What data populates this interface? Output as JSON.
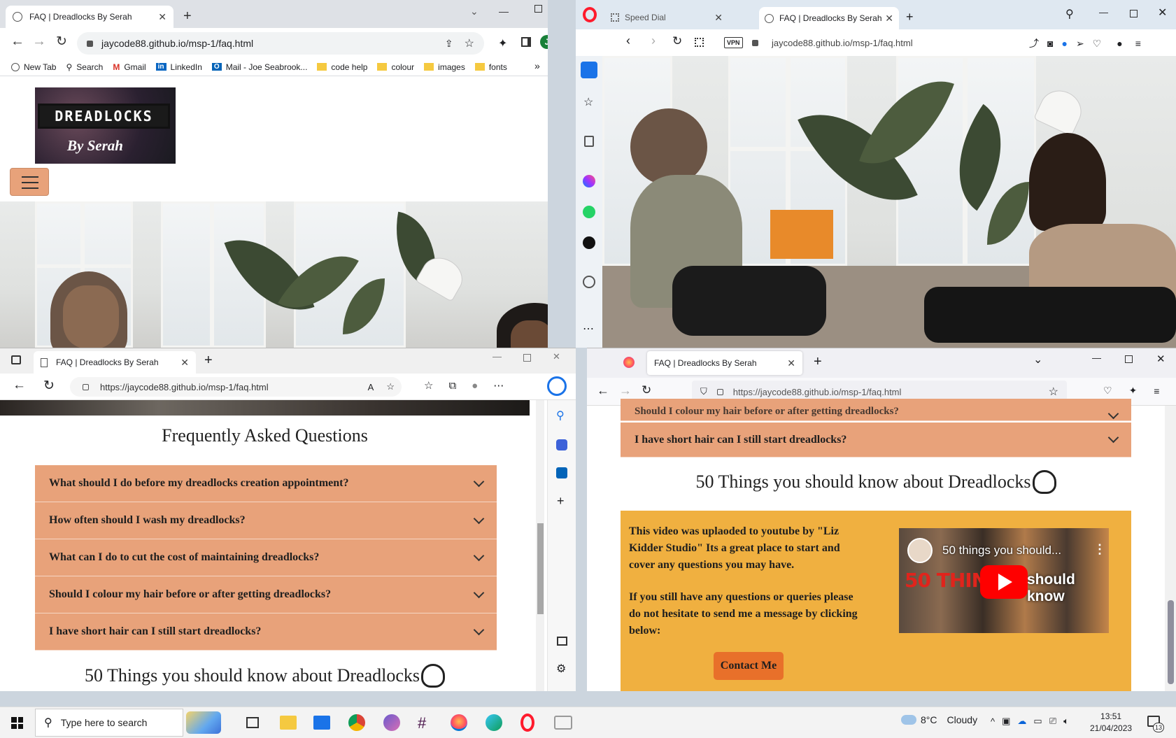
{
  "site": {
    "tab_title": "FAQ | Dreadlocks By Serah",
    "url_short": "jaycode88.github.io/msp-1/faq.html",
    "url_full": "https://jaycode88.github.io/msp-1/faq.html",
    "logo_line1": "DREADLOCKS",
    "logo_line2": "By Serah",
    "faq_heading": "Frequently Asked Questions",
    "faq_items": [
      "What should I do before my dreadlocks creation appointment?",
      "How often should I wash my dreadlocks?",
      "What can I do to cut the cost of maintaining dreadlocks?",
      "Should I colour my hair before or after getting dreadlocks?",
      "I have short hair can I still start dreadlocks?"
    ],
    "video_heading": "50 Things you should know about Dreadlocks",
    "video_text_1": "This video was uplaoded to youtube by \"Liz Kidder Studio\" Its a great place to start and cover any questions you may have.",
    "video_text_2": "If you still have any questions or queries please do not hesitate to send me a message by clicking below:",
    "contact_button": "Contact Me",
    "video_title": "50 things you should...",
    "video_thumb_text_red": "50 THING",
    "video_thumb_text_white": "should know"
  },
  "chrome": {
    "avatar_letter": "J",
    "bookmarks": [
      "New Tab",
      "Search",
      "Gmail",
      "LinkedIn",
      "Mail - Joe Seabrook...",
      "code help",
      "colour",
      "images",
      "fonts"
    ],
    "more": "»"
  },
  "opera": {
    "tab_speed_dial": "Speed Dial",
    "vpn_label": "VPN"
  },
  "colors": {
    "faq_bg": "#e8a27a",
    "video_section_bg": "#f0b040",
    "contact_btn": "#e8702a",
    "chrome_frame": "#dee1e6",
    "opera_frame": "#dfe8f1",
    "edge_frame": "#f0f0f0",
    "firefox_frame": "#f0f0f4"
  },
  "taskbar": {
    "search_placeholder": "Type here to search",
    "weather_temp": "8°C",
    "weather_desc": "Cloudy",
    "time": "13:51",
    "date": "21/04/2023",
    "notifications": "13"
  }
}
